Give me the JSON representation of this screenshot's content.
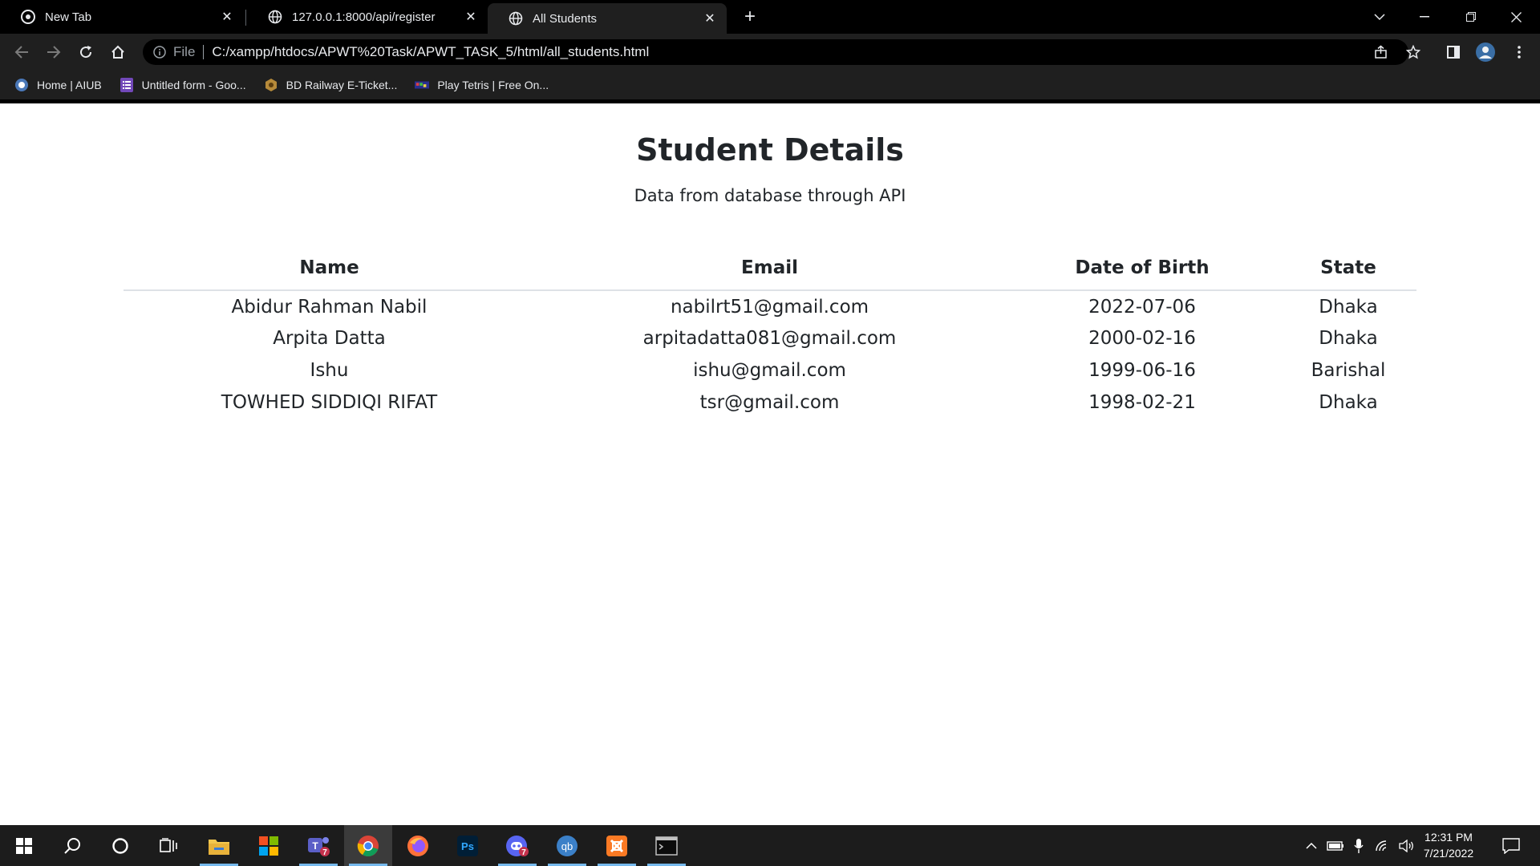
{
  "browser": {
    "tabs": [
      {
        "title": "New Tab",
        "active": false
      },
      {
        "title": "127.0.0.1:8000/api/register",
        "active": false
      },
      {
        "title": "All Students",
        "active": true
      }
    ],
    "address": {
      "scheme_label": "File",
      "url": "C:/xampp/htdocs/APWT%20Task/APWT_TASK_5/html/all_students.html"
    },
    "bookmarks": [
      {
        "label": "Home | AIUB",
        "icon": "aiub-logo-icon"
      },
      {
        "label": "Untitled form - Goo...",
        "icon": "google-forms-icon"
      },
      {
        "label": "BD Railway E-Ticket...",
        "icon": "railway-logo-icon"
      },
      {
        "label": "Play Tetris | Free On...",
        "icon": "tetris-icon"
      }
    ]
  },
  "page": {
    "title": "Student Details",
    "subtitle": "Data from database through API",
    "table": {
      "headers": [
        "Name",
        "Email",
        "Date of Birth",
        "State"
      ],
      "rows": [
        {
          "name": "Abidur Rahman Nabil",
          "email": "nabilrt51@gmail.com",
          "dob": "2022-07-06",
          "state": "Dhaka"
        },
        {
          "name": "Arpita Datta",
          "email": "arpitadatta081@gmail.com",
          "dob": "2000-02-16",
          "state": "Dhaka"
        },
        {
          "name": "Ishu",
          "email": "ishu@gmail.com",
          "dob": "1999-06-16",
          "state": "Barishal"
        },
        {
          "name": "TOWHED SIDDIQI RIFAT",
          "email": "tsr@gmail.com",
          "dob": "1998-02-21",
          "state": "Dhaka"
        }
      ]
    }
  },
  "taskbar": {
    "apps": [
      {
        "name": "file-explorer",
        "icon": "folder-icon"
      },
      {
        "name": "microsoft-store",
        "icon": "store-icon"
      },
      {
        "name": "teams",
        "icon": "teams-icon",
        "badge": "7"
      },
      {
        "name": "chrome",
        "icon": "chrome-icon",
        "active": true
      },
      {
        "name": "firefox",
        "icon": "firefox-icon"
      },
      {
        "name": "photoshop",
        "icon": "photoshop-icon",
        "label": "Ps"
      },
      {
        "name": "discord",
        "icon": "discord-icon",
        "badge": "7"
      },
      {
        "name": "qbittorrent",
        "icon": "qbittorrent-icon",
        "label": "qb"
      },
      {
        "name": "xampp",
        "icon": "xampp-icon"
      },
      {
        "name": "terminal",
        "icon": "terminal-icon"
      }
    ],
    "clock": {
      "time": "12:31 PM",
      "date": "7/21/2022"
    }
  },
  "colors": {
    "chrome_bg": "#000000",
    "toolbar_bg": "#1f1f1f",
    "page_text": "#212529",
    "table_rule": "#dee2e6",
    "taskbar_bg": "#1c1c1c",
    "taskbar_accent": "#76b9ed"
  }
}
